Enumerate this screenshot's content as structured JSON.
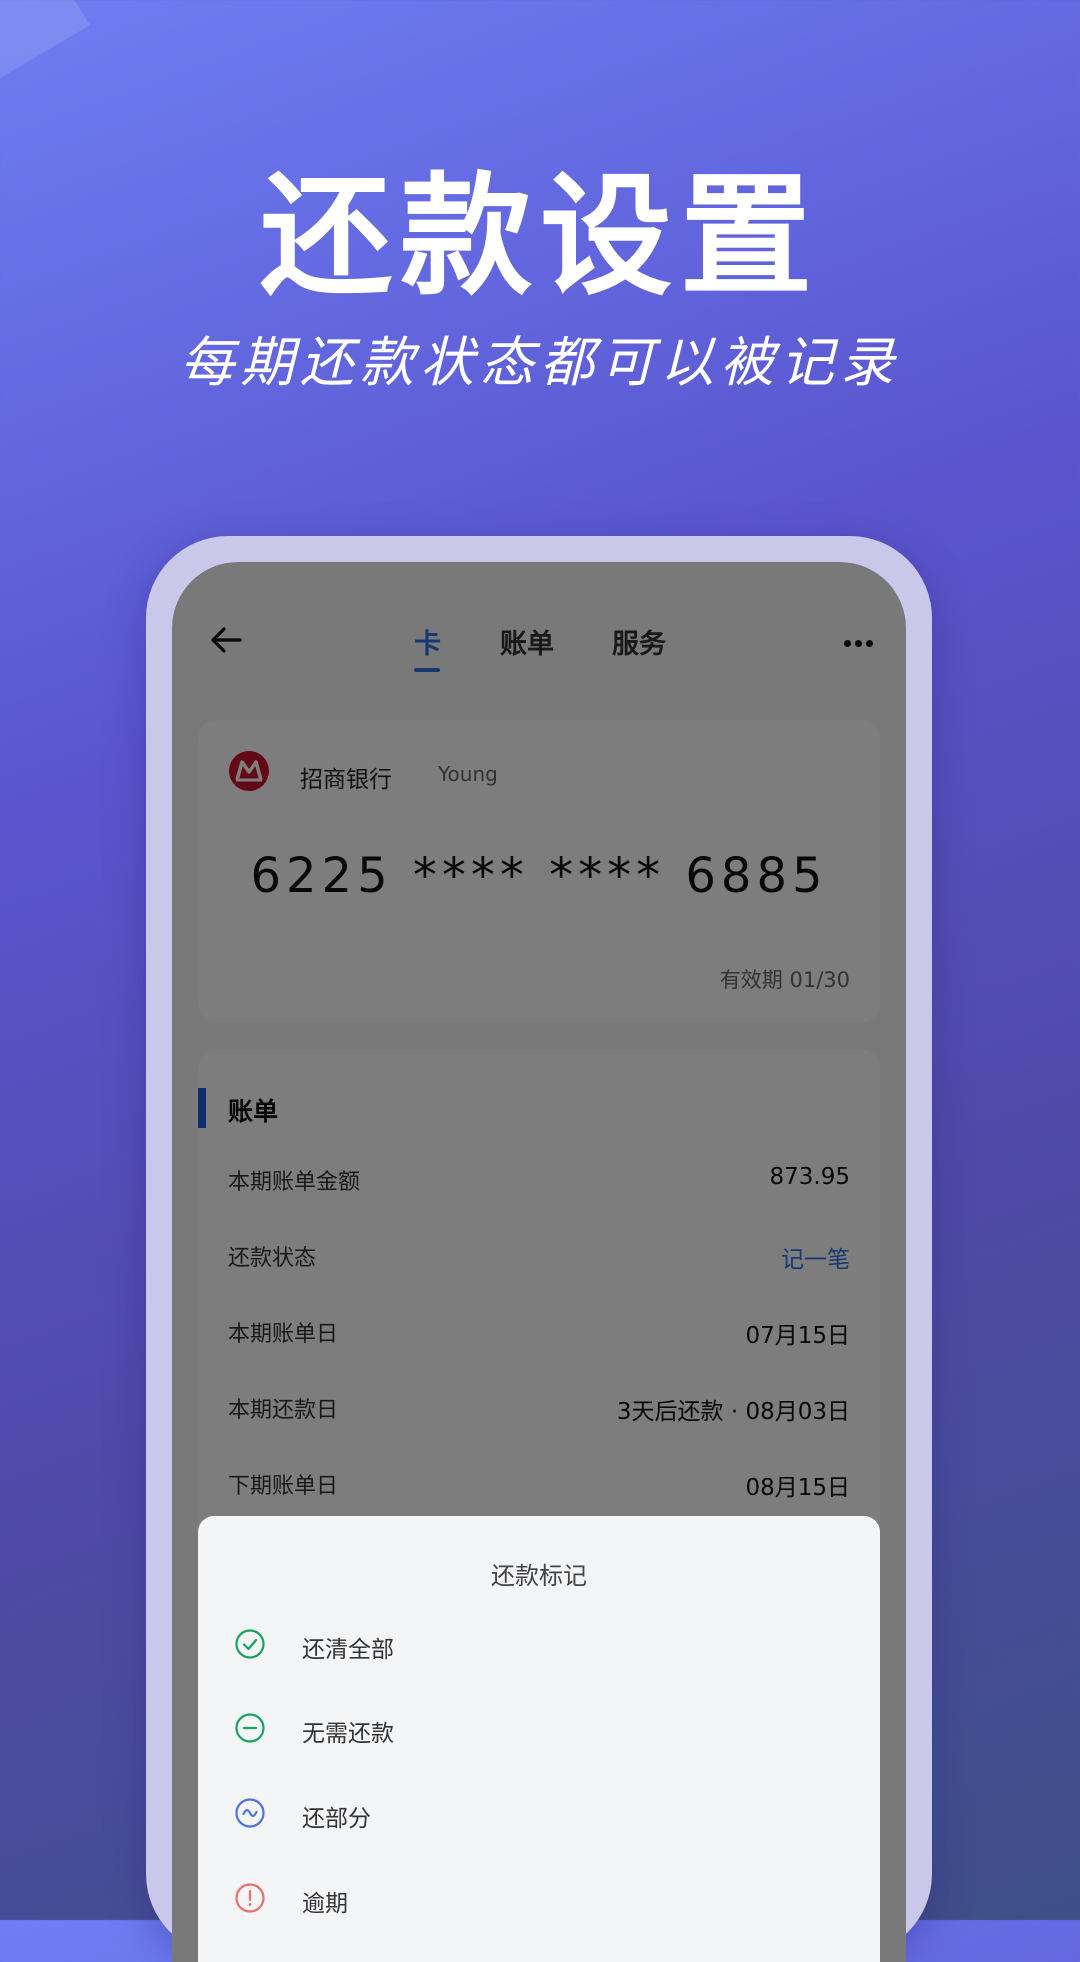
{
  "hero": {
    "title": "还款设置",
    "subtitle": "每期还款状态都可以被记录"
  },
  "topbar": {
    "tabs": [
      {
        "label": "卡",
        "active": true
      },
      {
        "label": "账单",
        "active": false
      },
      {
        "label": "服务",
        "active": false
      }
    ],
    "back_icon": "arrow-left-icon",
    "more_icon": "more-dots-icon"
  },
  "card": {
    "bank_name": "招商银行",
    "holder": "Young",
    "number": "6225 **** **** 6885",
    "expiry": "有效期 01/30",
    "logo_color": "#c8102e"
  },
  "bill": {
    "title": "账单",
    "rows": [
      {
        "label": "本期账单金额",
        "value": "873.95"
      },
      {
        "label": "还款状态",
        "value": "记一笔"
      },
      {
        "label": "本期账单日",
        "value": "07月15日"
      },
      {
        "label": "本期还款日",
        "value": "3天后还款 · 08月03日"
      },
      {
        "label": "下期账单日",
        "value": "08月15日"
      }
    ]
  },
  "sheet": {
    "title": "还款标记",
    "options": [
      {
        "label": "还清全部",
        "icon": "check-circle-icon",
        "color": "#1aa260"
      },
      {
        "label": "无需还款",
        "icon": "minus-circle-icon",
        "color": "#1aa260"
      },
      {
        "label": "还部分",
        "icon": "wave-circle-icon",
        "color": "#4b74e0"
      },
      {
        "label": "逾期",
        "icon": "alert-circle-icon",
        "color": "#e8706a"
      }
    ]
  },
  "colors": {
    "accent": "#2f6ee0",
    "bill_accent": "#1d5fd6",
    "frame": "#c9c8ea"
  }
}
